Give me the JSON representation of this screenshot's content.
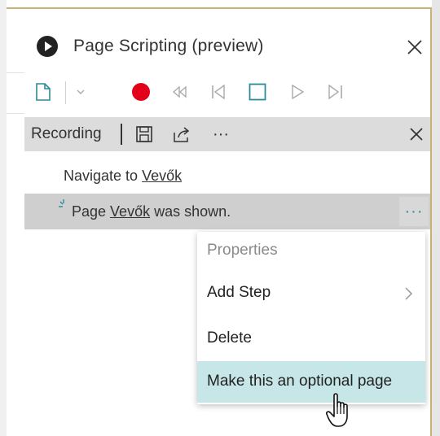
{
  "pane": {
    "title": "Page Scripting (preview)"
  },
  "recording_bar": {
    "label": "Recording"
  },
  "steps": [
    {
      "prefix": "Navigate to ",
      "link": "Vevők",
      "suffix": ""
    },
    {
      "prefix": "Page ",
      "link": "Vevők",
      "suffix": " was shown."
    }
  ],
  "more_glyph": "···",
  "context_menu": {
    "items": [
      {
        "label": "Properties",
        "disabled": true
      },
      {
        "label": "Add Step",
        "has_submenu": true
      },
      {
        "label": "Delete"
      },
      {
        "label": "Make this an optional page",
        "highlighted": true
      }
    ]
  },
  "colors": {
    "record_red": "#e3001b",
    "accent_teal": "#2b8a9a",
    "highlight": "#c7e6e8"
  },
  "icons": [
    "play-circle-icon",
    "close-icon",
    "new-document-icon",
    "chevron-down-icon",
    "record-icon",
    "rewind-icon",
    "step-back-icon",
    "stop-icon",
    "play-icon",
    "step-forward-icon",
    "save-icon",
    "share-icon",
    "more-icon",
    "chevron-right-icon",
    "hand-cursor-icon"
  ]
}
